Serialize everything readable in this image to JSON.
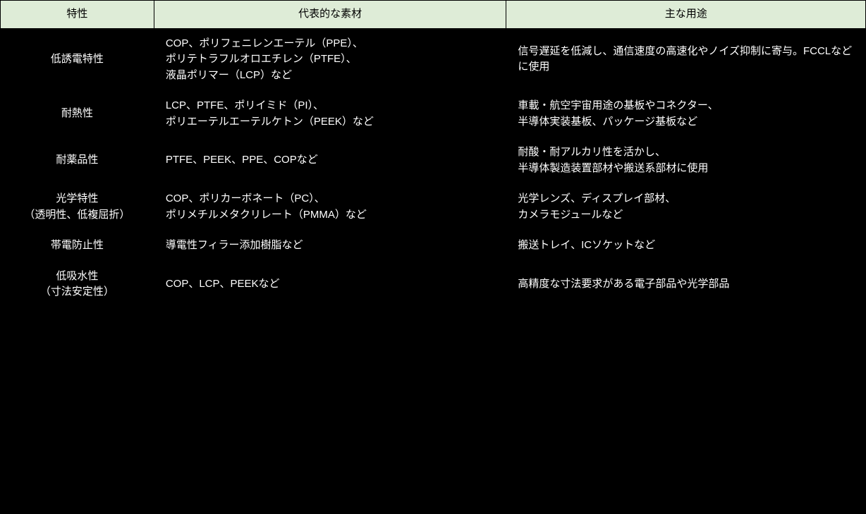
{
  "table": {
    "headers": {
      "trait": "特性",
      "material": "代表的な素材",
      "usage": "主な用途"
    },
    "rows": [
      {
        "trait": "低誘電特性",
        "material": "COP、ポリフェニレンエーテル（PPE）、\nポリテトラフルオロエチレン（PTFE）、\n液晶ポリマー（LCP）など",
        "usage": "信号遅延を低減し、通信速度の高速化やノイズ抑制に寄与。FCCLなどに使用"
      },
      {
        "trait": "耐熱性",
        "material": "LCP、PTFE、ポリイミド（PI）、\nポリエーテルエーテルケトン（PEEK）など",
        "usage": "車載・航空宇宙用途の基板やコネクター、\n半導体実装基板、パッケージ基板など"
      },
      {
        "trait": "耐薬品性",
        "material": "PTFE、PEEK、PPE、COPなど",
        "usage": "耐酸・耐アルカリ性を活かし、\n半導体製造装置部材や搬送系部材に使用"
      },
      {
        "trait": "光学特性\n（透明性、低複屈折）",
        "material": "COP、ポリカーボネート（PC）、\nポリメチルメタクリレート（PMMA）など",
        "usage": "光学レンズ、ディスプレイ部材、\nカメラモジュールなど"
      },
      {
        "trait": "帯電防止性",
        "material": "導電性フィラー添加樹脂など",
        "usage": "搬送トレイ、ICソケットなど"
      },
      {
        "trait": "低吸水性\n（寸法安定性）",
        "material": "COP、LCP、PEEKなど",
        "usage": "高精度な寸法要求がある電子部品や光学部品"
      }
    ]
  }
}
